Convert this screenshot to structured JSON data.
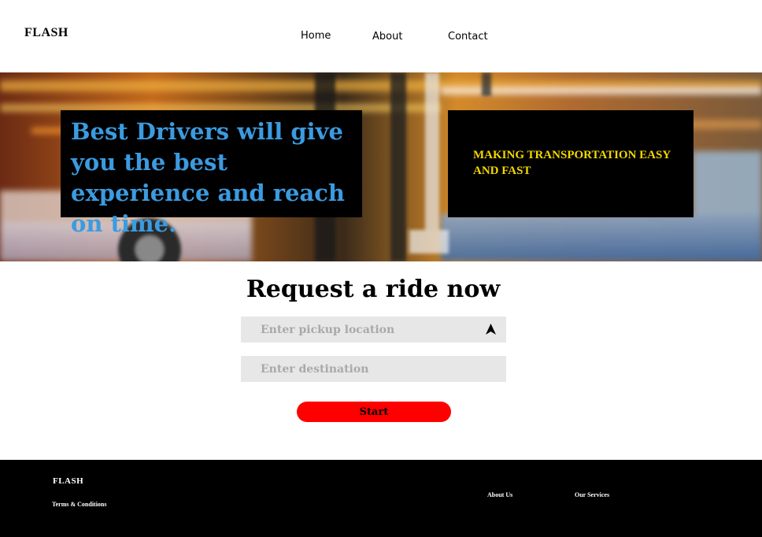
{
  "header": {
    "logo": "FLASH",
    "nav": [
      "Home",
      "About",
      "Contact"
    ]
  },
  "hero": {
    "headline": "Best Drivers will give you the best experience and reach on time.",
    "tagline": "MAKING TRANSPORTATION EASY AND FAST",
    "colors": {
      "headline": "#3b9be0",
      "tagline": "#f2d700",
      "box": "#000000"
    }
  },
  "ride_form": {
    "title": "Request a ride now",
    "pickup_placeholder": "Enter pickup location",
    "pickup_value": "",
    "destination_placeholder": "Enter destination",
    "destination_value": "",
    "locate_icon": "navigation-arrow-icon",
    "start_label": "Start",
    "start_color": "#ff0000"
  },
  "footer": {
    "logo": "FLASH",
    "terms": "Terms & Conditions",
    "about": "About Us",
    "services": "Our Services"
  }
}
